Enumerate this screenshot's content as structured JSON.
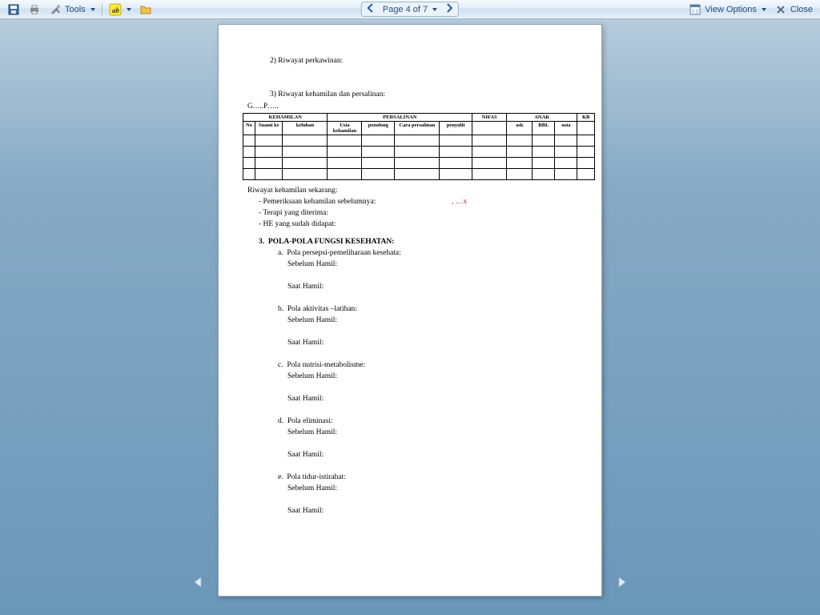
{
  "toolbar": {
    "tools_label": "Tools",
    "page_label": "Page 4 of 7",
    "view_options_label": "View Options",
    "close_label": "Close"
  },
  "doc": {
    "item2": "2)  Riwayat perkawinan:",
    "item3": "3)  Riwayat kehamilan dan persalinan:",
    "gp": "G…..P…..",
    "x_annot": ", …x",
    "table": {
      "top": {
        "kehamilan": "KEHAMILAN",
        "persalinan": "PERSALINAN",
        "nifas": "NIFAS",
        "anak": "ANAK",
        "kb": "KB"
      },
      "cols": {
        "no": "No",
        "suami": "Suami ke",
        "keluhan": "keluhan",
        "usia_k": "Usia kehamilan",
        "penolong": "penolong",
        "cara": "Cara persalinan",
        "penyulit": "penyulit",
        "ask": "ask",
        "bbl": "BBL",
        "usia": "usia"
      }
    },
    "riwayat_sekarang": "Riwayat kehamilan sekarang:",
    "b1": "-    Pemeriksaan kehamilan sebelumnya:",
    "b2": "-    Terapi yang diterima:",
    "b3": "-    HE yang sudah didapat:",
    "sec3_no": "3.",
    "sec3_title": "POLA-POLA FUNGSI KESEHATAN:",
    "items": [
      {
        "l": "a.",
        "t": "Pola persepsi-pemeliharaan kesehata:"
      },
      {
        "l": "b.",
        "t": "Pola aktivitas –latihan:"
      },
      {
        "l": "c.",
        "t": "Pola nutrisi-metabolisme:"
      },
      {
        "l": "d.",
        "t": "Pola eliminasi:"
      },
      {
        "l": "e.",
        "t": "Pola tidur-istirahat:"
      }
    ],
    "sebelum": "Sebelum Hamil:",
    "saat": "Saat Hamil:"
  }
}
